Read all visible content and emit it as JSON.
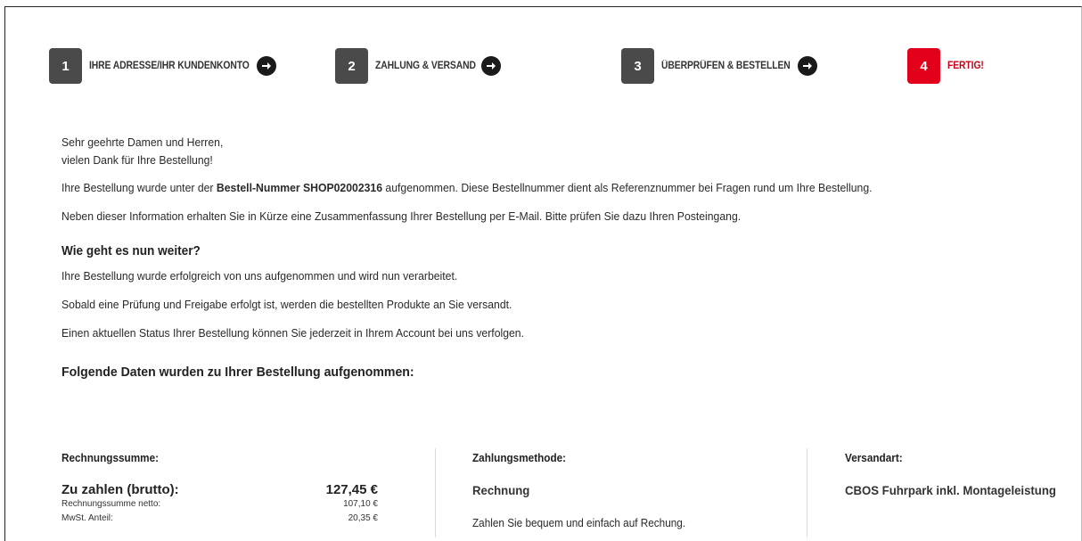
{
  "steps": [
    {
      "num": "1",
      "label": "IHRE ADRESSE/IHR KUNDENKONTO"
    },
    {
      "num": "2",
      "label": "ZAHLUNG & VERSAND"
    },
    {
      "num": "3",
      "label": "ÜBERPRÜFEN & BESTELLEN"
    },
    {
      "num": "4",
      "label": "FERTIG!"
    }
  ],
  "greeting": {
    "line1": "Sehr geehrte Damen und Herren,",
    "line2": "vielen Dank für Ihre Bestellung!"
  },
  "order": {
    "prefix": "Ihre Bestellung wurde unter der ",
    "number_label": "Bestell-Nummer SHOP02002316",
    "suffix": " aufgenommen. Diese Bestellnummer dient als Referenznummer bei Fragen rund um Ihre Bestellung."
  },
  "email_info": "Neben dieser Information erhalten Sie in Kürze eine Zusammenfassung Ihrer Bestellung per E-Mail. Bitte prüfen Sie dazu Ihren Posteingang.",
  "next": {
    "heading": "Wie geht es nun weiter?",
    "p1": "Ihre Bestellung wurde erfolgreich von uns aufgenommen und wird nun verarbeitet.",
    "p2": "Sobald eine Prüfung und Freigabe erfolgt ist, werden die bestellten Produkte an Sie versandt.",
    "p3": "Einen aktuellen Status Ihrer Bestellung können Sie jederzeit in Ihrem Account bei uns verfolgen."
  },
  "summary_heading": "Folgende Daten wurden zu Ihrer Bestellung aufgenommen:",
  "invoice": {
    "head": "Rechnungssumme:",
    "total_label": "Zu zahlen (brutto):",
    "total_value": "127,45 €",
    "net_label": "Rechnungssumme netto:",
    "net_value": "107,10 €",
    "vat_label": "MwSt. Anteil:",
    "vat_value": "20,35 €"
  },
  "payment": {
    "head": "Zahlungsmethode:",
    "method": "Rechnung",
    "desc": "Zahlen Sie bequem und einfach auf Rechung."
  },
  "shipping": {
    "head": "Versandart:",
    "method": "CBOS Fuhrpark inkl. Montageleistung"
  },
  "colors": {
    "step_inactive": "#4a4a4a",
    "step_active": "#e3001b",
    "step_active_label": "#c8001a"
  }
}
